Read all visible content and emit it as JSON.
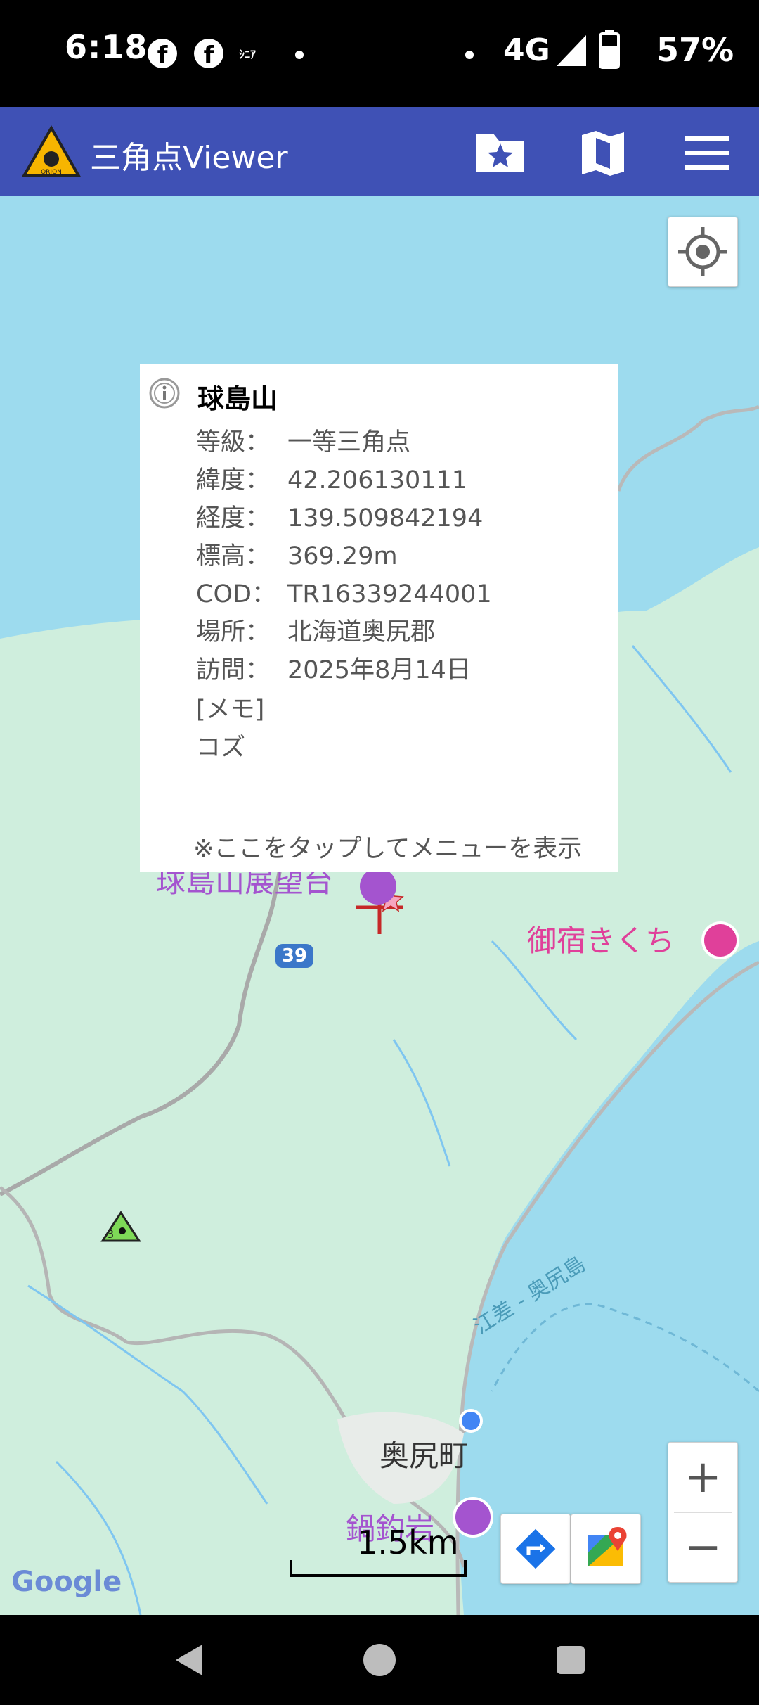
{
  "status_bar": {
    "time": "6:18",
    "notif_app_label": "ｼﾆｱ",
    "network": "4G",
    "battery_percent": "57%"
  },
  "app_bar": {
    "title": "三角点Viewer",
    "logo_text": "ORION",
    "icons": [
      "folder-star-icon",
      "map-icon",
      "menu-icon"
    ]
  },
  "info_window": {
    "name": "球島山",
    "rows": [
      {
        "key": "等級：",
        "value": "一等三角点"
      },
      {
        "key": "緯度：",
        "value": "42.206130111"
      },
      {
        "key": "経度：",
        "value": "139.509842194"
      },
      {
        "key": "標高：",
        "value": "369.29m"
      },
      {
        "key": "COD：",
        "value": "TR16339244001"
      },
      {
        "key": "場所：",
        "value": "北海道奥尻郡"
      },
      {
        "key": "訪問：",
        "value": "2025年8月14日"
      }
    ],
    "memo_label": "[メモ]",
    "memo": "コズ",
    "hint": "※ここをタップしてメニューを表示"
  },
  "map": {
    "labels": {
      "viewpoint": "球島山展望台",
      "inn": "御宿きくち",
      "town": "奥尻町",
      "rock": "鍋釣岩",
      "route": "39",
      "ferry": "江差 - 奥尻島",
      "small_marker": "3"
    },
    "scale": "1.5km",
    "attribution": "Google",
    "colors": {
      "land": "#cfeedd",
      "sea": "#9ddbee",
      "poi_purple": "#a454cf",
      "poi_pink": "#e0409a",
      "appbar": "#3f51b5"
    }
  },
  "controls": {
    "zoom_in": "+",
    "zoom_out": "−"
  }
}
